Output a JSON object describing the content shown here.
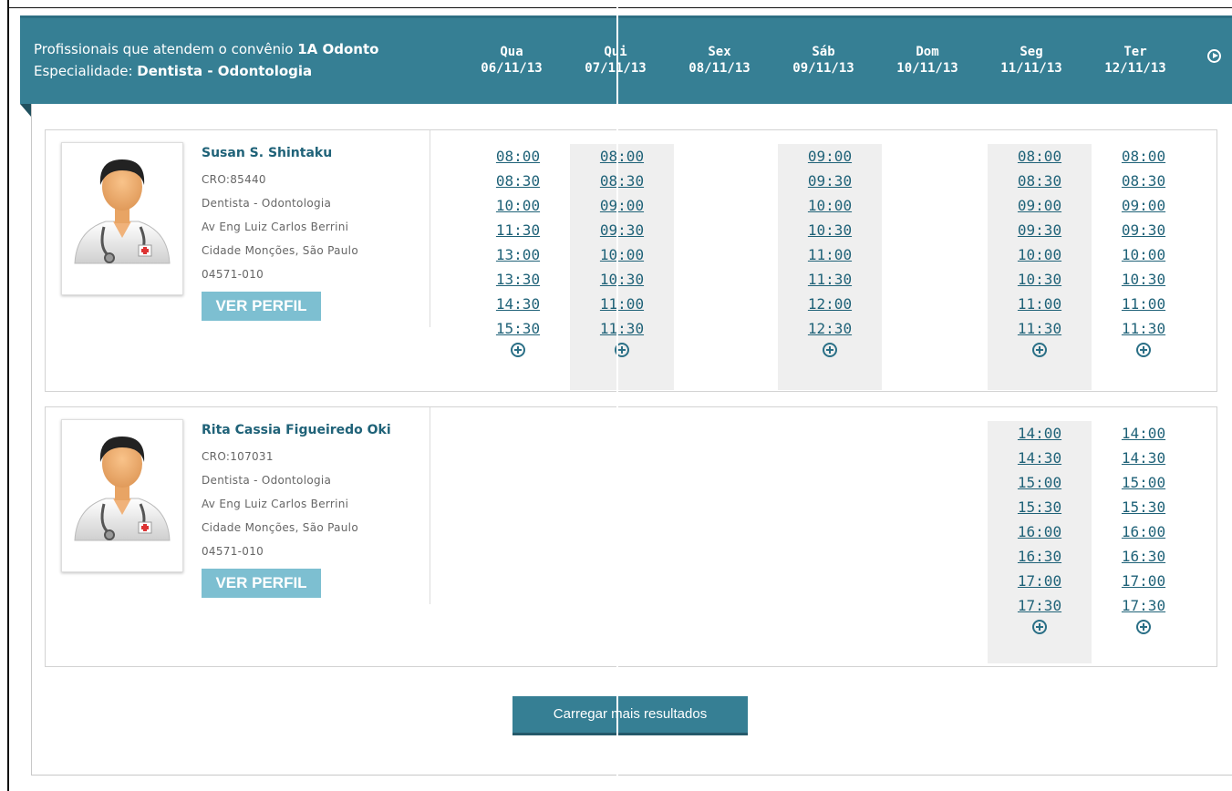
{
  "header": {
    "line1_prefix": "Profissionais que atendem o convênio ",
    "line1_plan": "1A Odonto",
    "line2_prefix": "Especialidade: ",
    "line2_specialty": "Dentista - Odontologia"
  },
  "days": [
    {
      "name": "Qua",
      "date": "06/11/13"
    },
    {
      "name": "Qui",
      "date": "07/11/13"
    },
    {
      "name": "Sex",
      "date": "08/11/13"
    },
    {
      "name": "Sáb",
      "date": "09/11/13"
    },
    {
      "name": "Dom",
      "date": "10/11/13"
    },
    {
      "name": "Seg",
      "date": "11/11/13"
    },
    {
      "name": "Ter",
      "date": "12/11/13"
    }
  ],
  "professionals": [
    {
      "name": "Susan S. Shintaku",
      "cro": "CRO:85440",
      "specialty": "Dentista - Odontologia",
      "address": "Av Eng Luiz Carlos Berrini",
      "city": "Cidade Monções, São Paulo",
      "zip": "04571-010",
      "profile_label": "VER PERFIL",
      "slots": {
        "qua": [
          "08:00",
          "08:30",
          "10:00",
          "11:30",
          "13:00",
          "13:30",
          "14:30",
          "15:30"
        ],
        "qui": [
          "08:00",
          "08:30",
          "09:00",
          "09:30",
          "10:00",
          "10:30",
          "11:00",
          "11:30"
        ],
        "sab": [
          "09:00",
          "09:30",
          "10:00",
          "10:30",
          "11:00",
          "11:30",
          "12:00",
          "12:30"
        ],
        "seg": [
          "08:00",
          "08:30",
          "09:00",
          "09:30",
          "10:00",
          "10:30",
          "11:00",
          "11:30"
        ],
        "ter": [
          "08:00",
          "08:30",
          "09:00",
          "09:30",
          "10:00",
          "10:30",
          "11:00",
          "11:30"
        ]
      }
    },
    {
      "name": "Rita Cassia Figueiredo Oki",
      "cro": "CRO:107031",
      "specialty": "Dentista - Odontologia",
      "address": "Av Eng Luiz Carlos Berrini",
      "city": "Cidade Monções, São Paulo",
      "zip": "04571-010",
      "profile_label": "VER PERFIL",
      "slots": {
        "seg": [
          "14:00",
          "14:30",
          "15:00",
          "15:30",
          "16:00",
          "16:30",
          "17:00",
          "17:30"
        ],
        "ter": [
          "14:00",
          "14:30",
          "15:00",
          "15:30",
          "16:00",
          "16:30",
          "17:00",
          "17:30"
        ]
      }
    }
  ],
  "load_more_label": "Carregar mais resultados",
  "icons": {
    "next": "circle-play-icon",
    "more": "circle-plus-icon",
    "avatar": "doctor-avatar-icon"
  },
  "colors": {
    "header_bg": "#367f94",
    "link": "#1f6278",
    "button_light": "#7dbfd1",
    "shaded_col": "#efefef"
  }
}
